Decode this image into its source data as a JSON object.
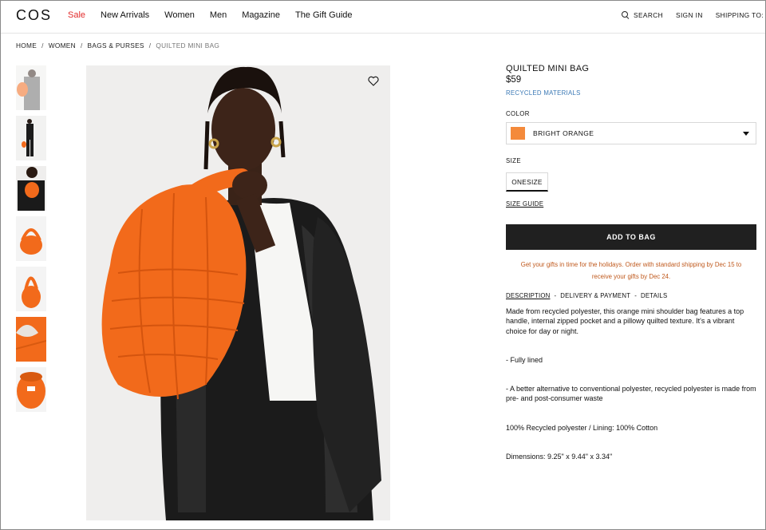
{
  "header": {
    "logo": "COS",
    "nav": [
      "Sale",
      "New Arrivals",
      "Women",
      "Men",
      "Magazine",
      "The Gift Guide"
    ],
    "search_label": "SEARCH",
    "sign_in_label": "SIGN IN",
    "shipping_label": "SHIPPING TO:"
  },
  "breadcrumb": [
    "HOME",
    "WOMEN",
    "BAGS & PURSES",
    "QUILTED MINI BAG"
  ],
  "breadcrumb_sep": "/",
  "product": {
    "title": "QUILTED MINI BAG",
    "price": "$59",
    "tag": "RECYCLED MATERIALS",
    "color_label": "COLOR",
    "color_value": "BRIGHT ORANGE",
    "swatch_color": "#f48a3b",
    "size_label": "SIZE",
    "size_value": "ONESIZE",
    "size_guide": "SIZE GUIDE",
    "add_to_bag": "ADD TO BAG",
    "holiday_line1": "Get your gifts in time for the holidays. Order with standard shipping by Dec 15 to",
    "holiday_line2": "receive your gifts by Dec 24.",
    "tabs": [
      "DESCRIPTION",
      "DELIVERY & PAYMENT",
      "DETAILS"
    ],
    "description": [
      "Made from recycled polyester, this orange mini shoulder bag features a top handle, internal zipped pocket and a pillowy quilted texture. It's a vibrant choice for day or night.",
      "- Fully lined",
      "- A better alternative to conventional polyester, recycled polyester is made from pre- and post-consumer waste",
      "100% Recycled polyester / Lining: 100% Cotton",
      "Dimensions: 9.25\" x 9.44\" x 3.34\""
    ]
  },
  "colors": {
    "sale": "#e22c2c",
    "accent_link": "#3a78b5",
    "holiday_text": "#c05a1e",
    "button_bg": "#202020",
    "bag_orange": "#f26a1b"
  }
}
